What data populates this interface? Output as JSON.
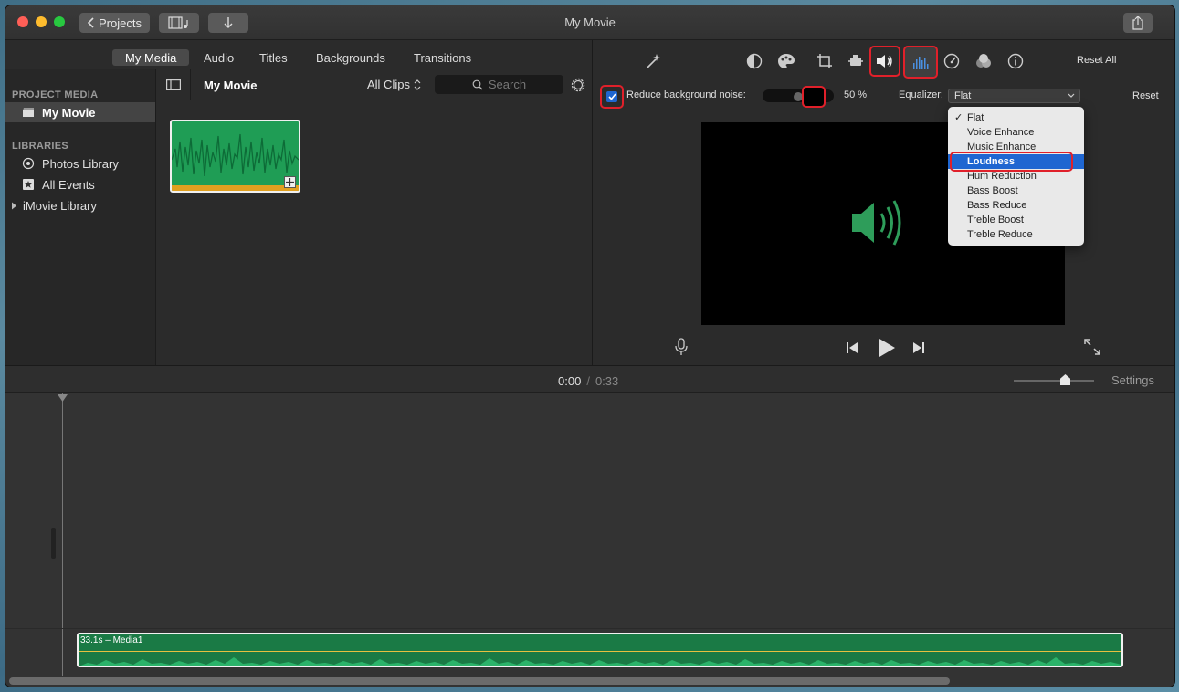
{
  "window": {
    "title": "My Movie"
  },
  "titlebar": {
    "projects_label": "Projects"
  },
  "media_tabs": [
    "My Media",
    "Audio",
    "Titles",
    "Backgrounds",
    "Transitions"
  ],
  "sidebar": {
    "project_media_header": "PROJECT MEDIA",
    "project_item": "My Movie",
    "libraries_header": "LIBRARIES",
    "library_items": [
      "Photos Library",
      "All Events",
      "iMovie Library"
    ]
  },
  "browser": {
    "title": "My Movie",
    "filter": "All Clips",
    "search_placeholder": "Search"
  },
  "inspector": {
    "reset_all": "Reset All",
    "noise_label": "Reduce background noise:",
    "noise_checked": true,
    "noise_value": "50 %",
    "noise_level": 0.5,
    "equalizer_label": "Equalizer:",
    "equalizer_value": "Flat",
    "reset": "Reset",
    "equalizer_options": [
      "Flat",
      "Voice Enhance",
      "Music Enhance",
      "Loudness",
      "Hum Reduction",
      "Bass Boost",
      "Bass Reduce",
      "Treble Boost",
      "Treble Reduce"
    ],
    "equalizer_checked": "Flat",
    "equalizer_highlighted": "Loudness"
  },
  "timeline": {
    "current_time": "0:00",
    "separator": "/",
    "total_time": "0:33",
    "settings": "Settings",
    "clip_label": "33.1s – Media1"
  },
  "colors": {
    "accent_red": "#e0202a",
    "clip_green": "#1f9d55",
    "selection_blue": "#1f66d1"
  }
}
